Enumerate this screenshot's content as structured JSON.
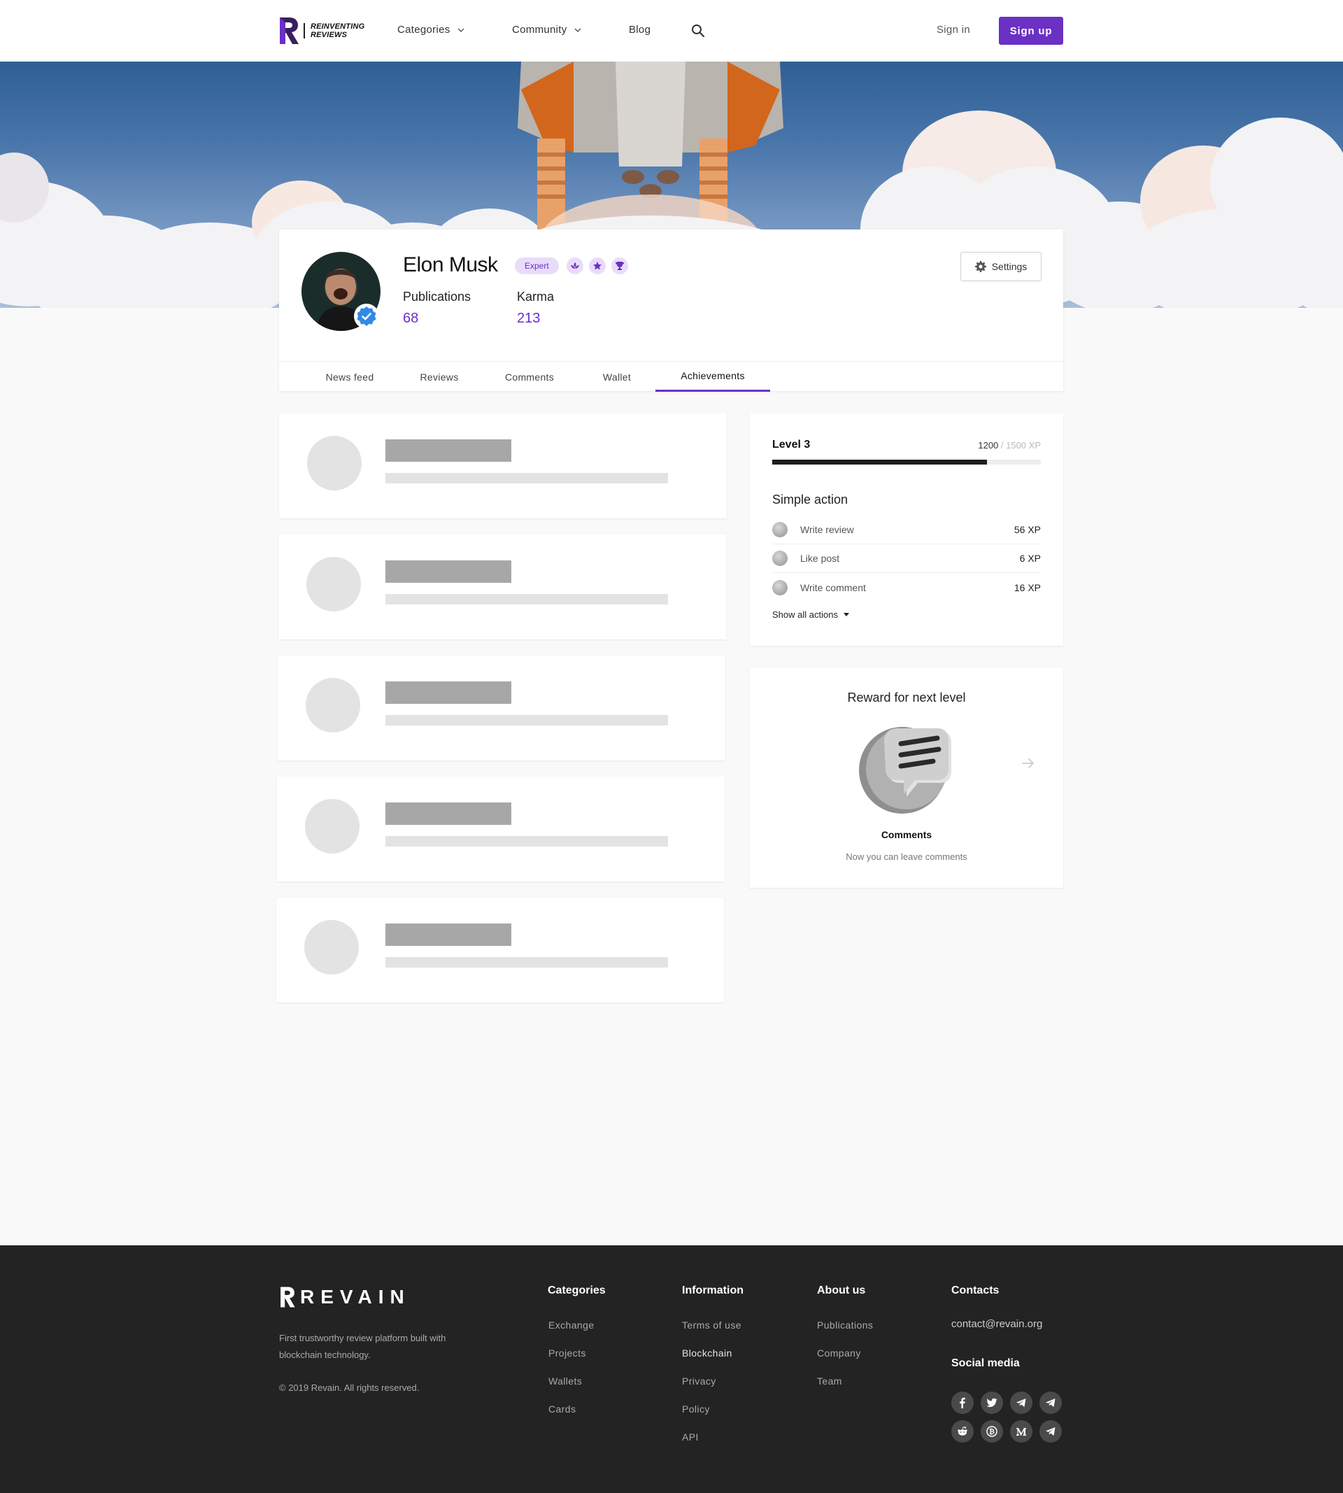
{
  "header": {
    "logo_text_line1": "REINVENTING",
    "logo_text_line2": "REVIEWS",
    "nav": {
      "categories": "Categories",
      "community": "Community",
      "blog": "Blog"
    },
    "sign_in": "Sign in",
    "sign_up": "Sign up"
  },
  "profile": {
    "name": "Elon Musk",
    "badge": "Expert",
    "stats": {
      "publications_label": "Publications",
      "publications_value": "68",
      "karma_label": "Karma",
      "karma_value": "213"
    },
    "settings_label": "Settings",
    "tabs": [
      {
        "label": "News feed"
      },
      {
        "label": "Reviews"
      },
      {
        "label": "Comments"
      },
      {
        "label": "Wallet"
      },
      {
        "label": "Achievements"
      }
    ],
    "active_tab": "Achievements"
  },
  "level": {
    "title": "Level 3",
    "xp_current": "1200",
    "xp_max": " / 1500 XP",
    "progress_fraction": 0.8,
    "simple_action_title": "Simple action",
    "actions": [
      {
        "label": "Write review",
        "xp": "56 XP"
      },
      {
        "label": "Like post",
        "xp": "6 XP"
      },
      {
        "label": "Write comment",
        "xp": "16 XP"
      }
    ],
    "show_all": "Show all actions"
  },
  "reward": {
    "title": "Reward for next level",
    "name": "Comments",
    "description": "Now you can leave comments"
  },
  "footer": {
    "brand": "REVAIN",
    "description": "First trustworthy review platform built with blockchain technology.",
    "copyright": "© 2019 Revain. All rights reserved.",
    "columns": {
      "categories": {
        "title": "Categories",
        "links": [
          "Exchange",
          "Projects",
          "Wallets",
          "Cards"
        ]
      },
      "information": {
        "title": "Information",
        "links": [
          "Terms of use",
          "Blockchain",
          "Privacy",
          "Policy",
          "API"
        ]
      },
      "about": {
        "title": "About us",
        "links": [
          "Publications",
          "Company",
          "Team"
        ]
      },
      "contacts": {
        "title": "Contacts",
        "email": "contact@revain.org",
        "social_title": "Social media"
      }
    },
    "social_icons": [
      "facebook-icon",
      "twitter-icon",
      "telegram-icon",
      "telegram-icon",
      "reddit-icon",
      "bitcoin-icon",
      "medium-icon",
      "telegram-icon"
    ]
  },
  "colors": {
    "accent": "#6b30c4",
    "badge_bg": "#e9dcfb",
    "footer_bg": "#232323"
  }
}
